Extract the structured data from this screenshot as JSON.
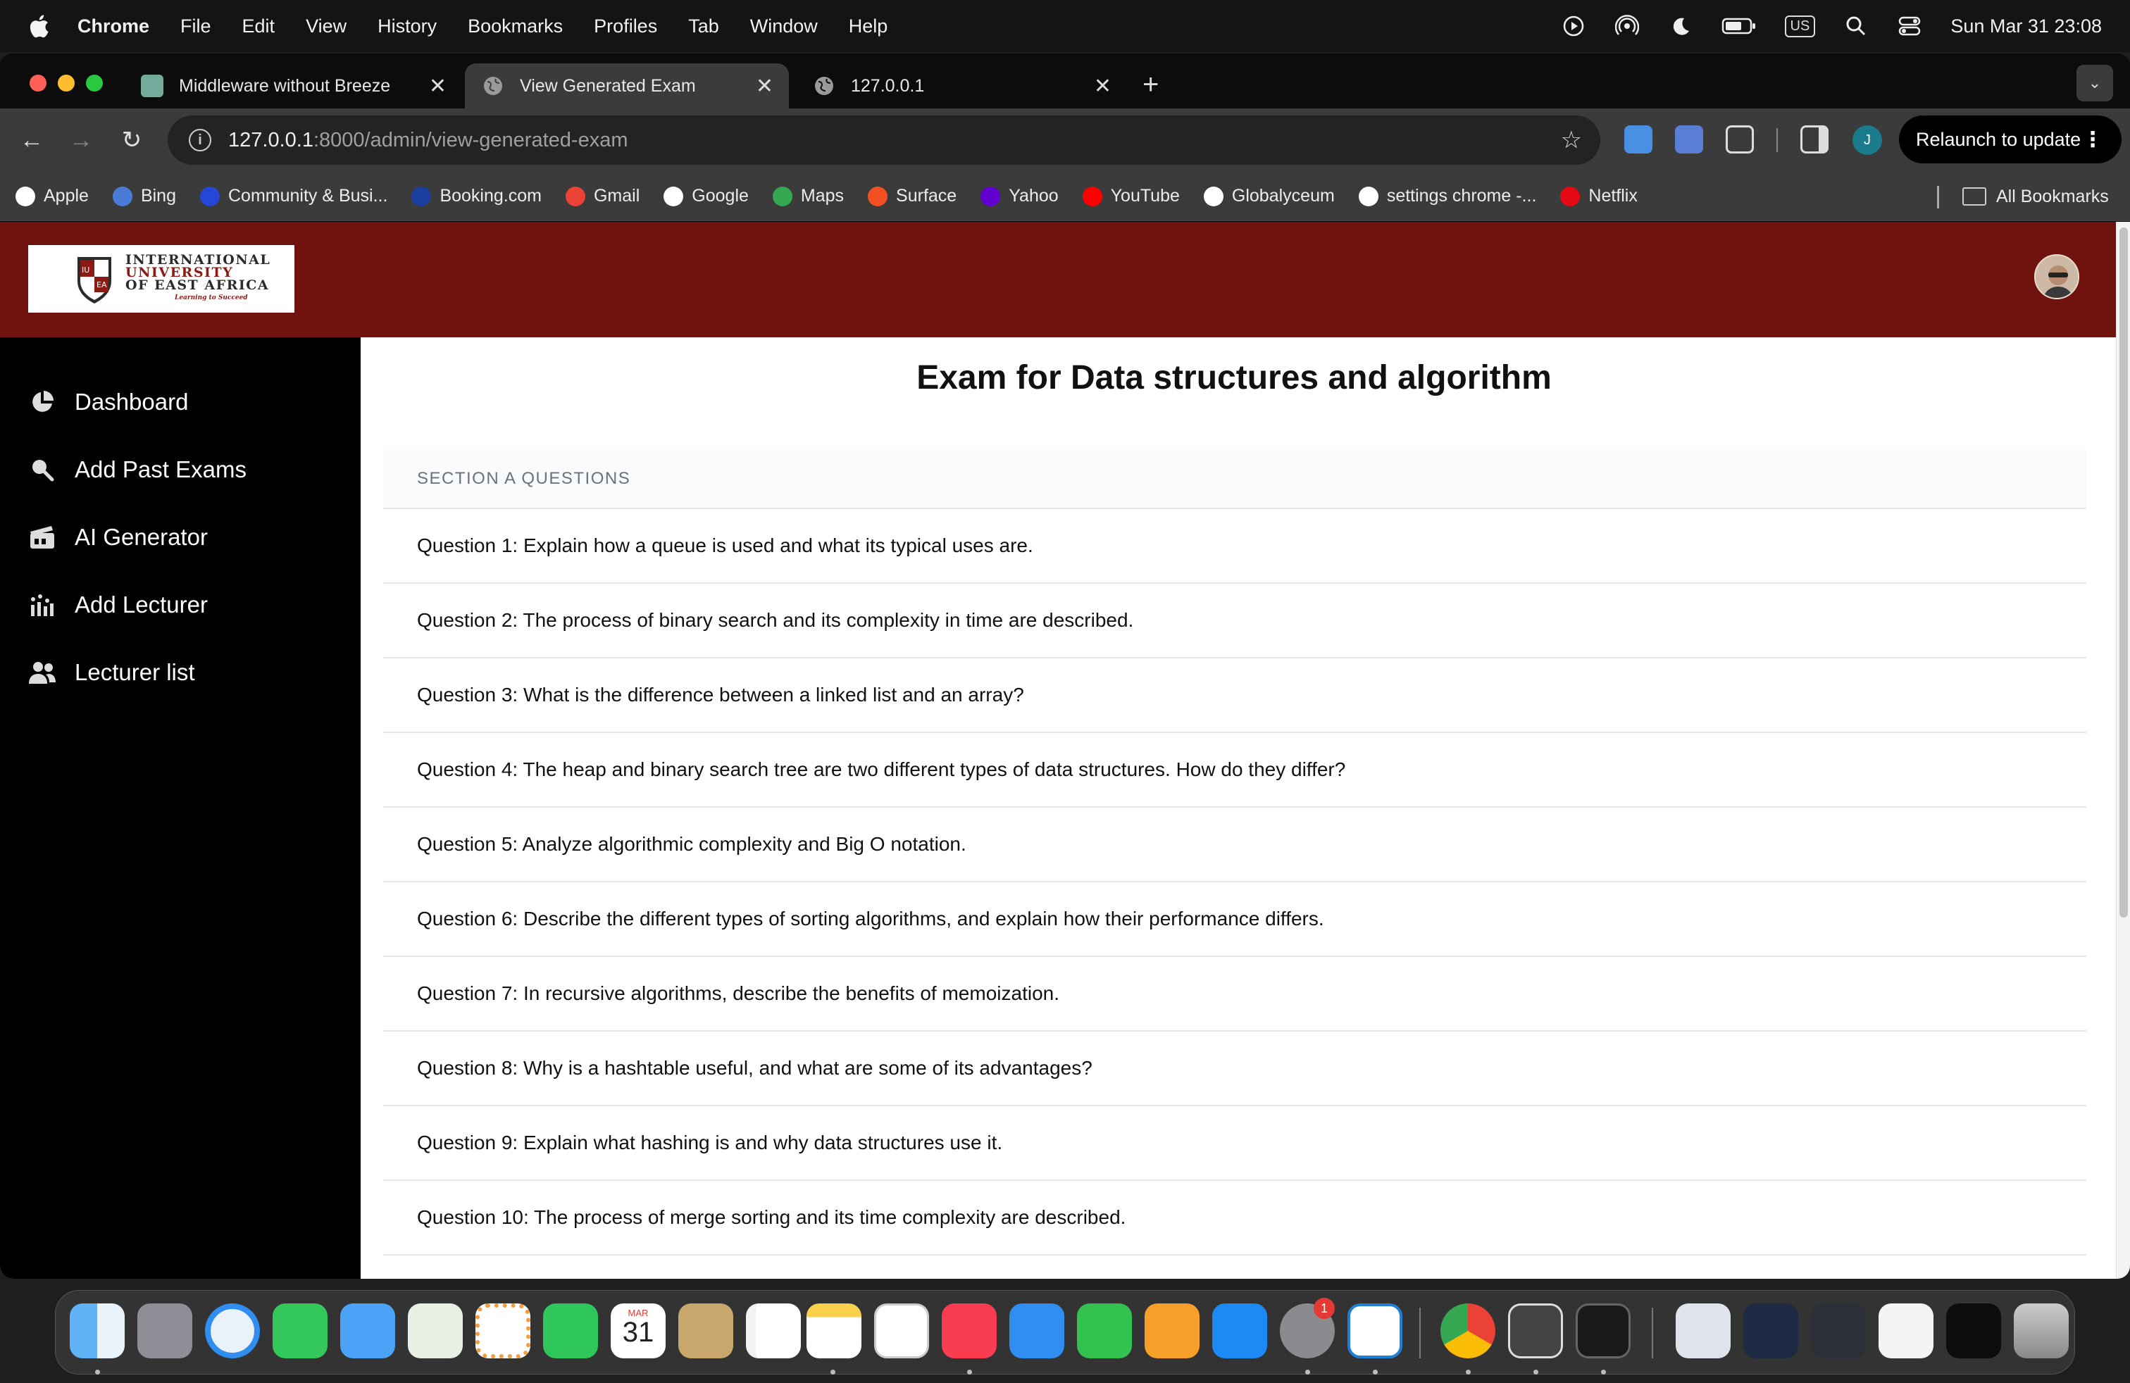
{
  "menubar": {
    "app": "Chrome",
    "items": [
      "File",
      "Edit",
      "View",
      "History",
      "Bookmarks",
      "Profiles",
      "Tab",
      "Window",
      "Help"
    ],
    "input_source": "US",
    "clock": "Sun Mar 31  23:08"
  },
  "tabs": [
    {
      "title": "Middleware without Breeze",
      "active": false
    },
    {
      "title": "View Generated Exam",
      "active": true
    },
    {
      "title": "127.0.0.1",
      "active": false
    }
  ],
  "address_bar": {
    "host": "127.0.0.1",
    "path": ":8000/admin/view-generated-exam"
  },
  "relaunch_label": "Relaunch to update",
  "profile_initial": "J",
  "bookmarks": [
    {
      "label": "Apple",
      "icon": "globe-icon",
      "color": "#ffffff"
    },
    {
      "label": "Bing",
      "icon": "search-icon",
      "color": "#4a7bd8"
    },
    {
      "label": "Community & Busi...",
      "icon": "community-icon",
      "color": "#2546d6"
    },
    {
      "label": "Booking.com",
      "icon": "booking-icon",
      "color": "#1b3f9e"
    },
    {
      "label": "Gmail",
      "icon": "gmail-icon",
      "color": "#ea4335"
    },
    {
      "label": "Google",
      "icon": "google-icon",
      "color": "#ffffff"
    },
    {
      "label": "Maps",
      "icon": "maps-icon",
      "color": "#34a853"
    },
    {
      "label": "Surface",
      "icon": "windows-icon",
      "color": "#f25022"
    },
    {
      "label": "Yahoo",
      "icon": "yahoo-icon",
      "color": "#6001d2"
    },
    {
      "label": "YouTube",
      "icon": "youtube-icon",
      "color": "#ff0000"
    },
    {
      "label": "Globalyceum",
      "icon": "globe-icon",
      "color": "#ffffff"
    },
    {
      "label": "settings chrome -...",
      "icon": "google-icon",
      "color": "#ffffff"
    },
    {
      "label": "Netflix",
      "icon": "netflix-icon",
      "color": "#e50914"
    }
  ],
  "all_bookmarks_label": "All Bookmarks",
  "site": {
    "logo": {
      "line1": "INTERNATIONAL",
      "line2": "UNIVERSITY",
      "line3": "OF EAST AFRICA",
      "motto": "Learning to Succeed"
    },
    "colors": {
      "header": "#70130f",
      "sidebar": "#000000"
    }
  },
  "sidebar": {
    "items": [
      {
        "label": "Dashboard",
        "icon": "pie-chart-icon"
      },
      {
        "label": "Add Past Exams",
        "icon": "search-doc-icon"
      },
      {
        "label": "AI Generator",
        "icon": "clapper-icon"
      },
      {
        "label": "Add Lecturer",
        "icon": "analytics-icon"
      },
      {
        "label": "Lecturer list",
        "icon": "users-icon"
      }
    ]
  },
  "exam": {
    "title": "Exam for Data structures and algorithm",
    "section_header": "SECTION A QUESTIONS",
    "questions": [
      "Question 1: Explain how a queue is used and what its typical uses are.",
      "Question 2: The process of binary search and its complexity in time are described.",
      "Question 3: What is the difference between a linked list and an array?",
      "Question 4: The heap and binary search tree are two different types of data structures. How do they differ?",
      "Question 5: Analyze algorithmic complexity and Big O notation.",
      "Question 6: Describe the different types of sorting algorithms, and explain how their performance differs.",
      "Question 7: In recursive algorithms, describe the benefits of memoization.",
      "Question 8: Why is a hashtable useful, and what are some of its advantages?",
      "Question 9: Explain what hashing is and why data structures use it.",
      "Question 10: The process of merge sorting and its time complexity are described."
    ]
  },
  "dock": {
    "calendar_month": "MAR",
    "calendar_day": "31",
    "settings_badge": "1"
  }
}
